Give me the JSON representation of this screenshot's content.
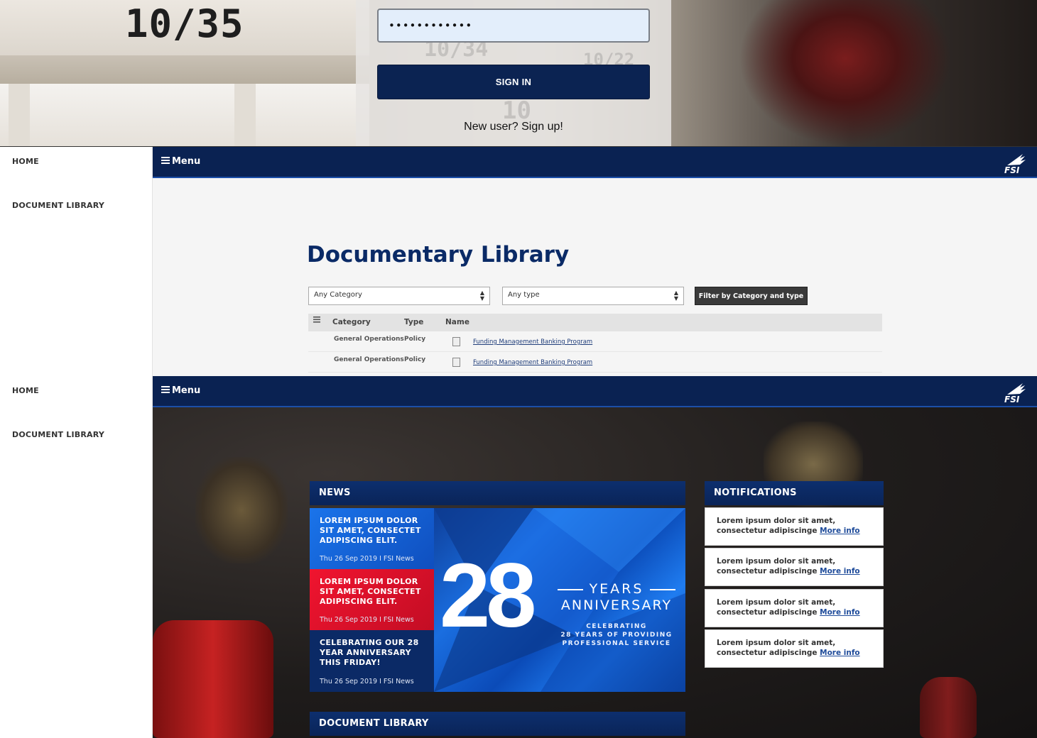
{
  "login": {
    "password_value": "••••••••••••",
    "sign_in_label": "SIGN IN",
    "signup_text": "New user? Sign up!",
    "background_numbers": [
      "10/35",
      "10/34",
      "10/22",
      "10"
    ]
  },
  "sidebar": {
    "items": [
      {
        "label": "HOME"
      },
      {
        "label": "DOCUMENT LIBRARY"
      }
    ]
  },
  "topbar": {
    "menu_label": "Menu",
    "logo_text": "FSI",
    "color": "#0a2252"
  },
  "doc_library": {
    "title": "Documentary Library",
    "category_select": "Any Category",
    "type_select": "Any type",
    "filter_button": "Filter by Category and type",
    "columns": [
      "Category",
      "Type",
      "Name"
    ],
    "rows": [
      {
        "category": "General Operations",
        "type": "Policy",
        "name": "Funding Management Banking Program"
      },
      {
        "category": "General Operations",
        "type": "Policy",
        "name": "Funding Management Banking Program"
      }
    ]
  },
  "dashboard": {
    "news_heading": "NEWS",
    "news": [
      {
        "title": "LOREM IPSUM DOLOR SIT AMET, CONSECTET ADIPISCING ELIT.",
        "meta": "Thu 26 Sep 2019 I FSI News",
        "color": "#1565d8"
      },
      {
        "title": "LOREM IPSUM DOLOR SIT AMET, CONSECTET ADIPISCING ELIT.",
        "meta": "Thu 26 Sep 2019 I FSI News",
        "color": "#e0112b"
      },
      {
        "title": "CELEBRATING OUR 28 YEAR ANNIVERSARY THIS FRIDAY!",
        "meta": "Thu 26 Sep 2019 I FSI News",
        "color": "#0b2a66"
      }
    ],
    "feature": {
      "number": "28",
      "years": "YEARS",
      "anniversary": "ANNIVERSARY",
      "subtitle_lines": [
        "CELEBRATING",
        "28 YEARS OF PROVIDING",
        "PROFESSIONAL SERVICE"
      ]
    },
    "notifications_heading": "NOTIFICATIONS",
    "notifications": [
      {
        "line1": "Lorem ipsum dolor sit amet,",
        "line2": "consectetur adipiscinge",
        "link": "More info"
      },
      {
        "line1": "Lorem ipsum dolor sit amet,",
        "line2": "consectetur adipiscinge",
        "link": "More info"
      },
      {
        "line1": "Lorem ipsum dolor sit amet,",
        "line2": "consectetur adipiscinge",
        "link": "More info"
      },
      {
        "line1": "Lorem ipsum dolor sit amet,",
        "line2": "consectetur adipiscinge",
        "link": "More info"
      }
    ],
    "doc_library_heading": "DOCUMENT LIBRARY"
  }
}
